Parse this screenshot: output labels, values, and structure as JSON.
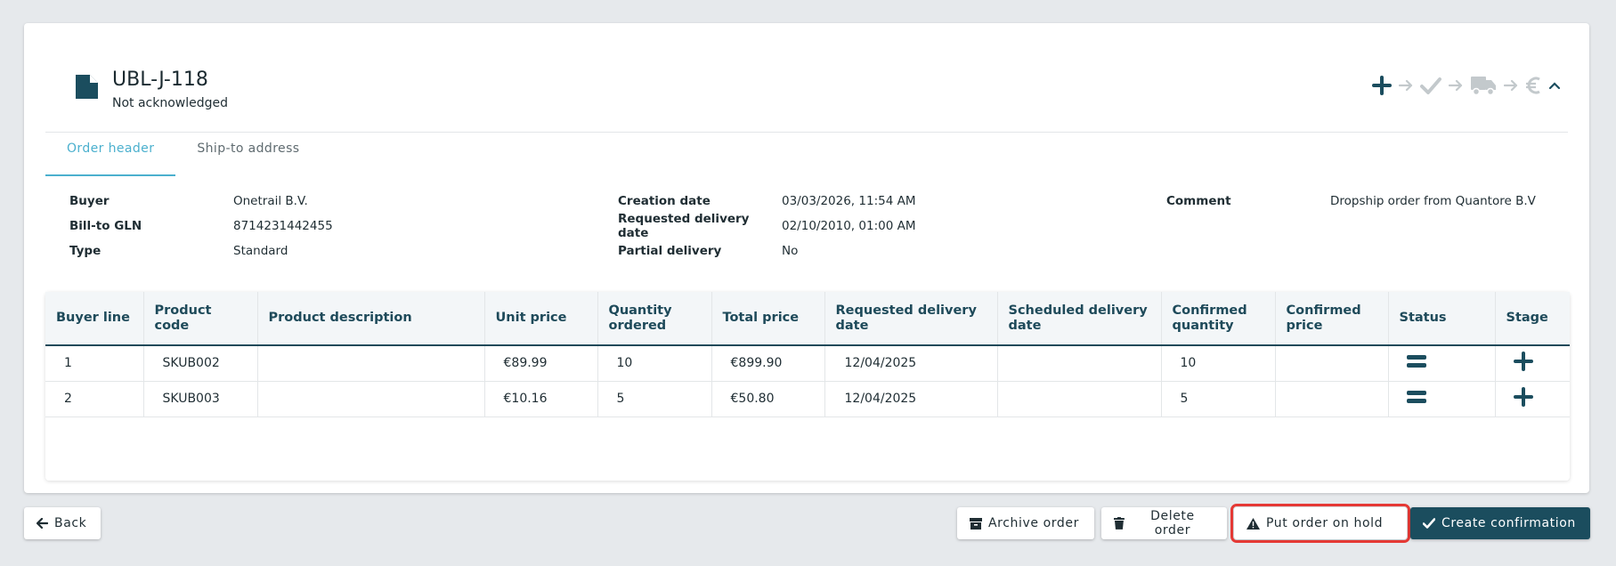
{
  "order": {
    "title": "UBL-J-118",
    "status": "Not acknowledged"
  },
  "stage_icons": [
    "plus-icon",
    "arrow-right-icon",
    "check-icon",
    "arrow-right-icon",
    "truck-icon",
    "arrow-right-icon",
    "euro-icon",
    "chevron-up-icon"
  ],
  "tabs": [
    {
      "label": "Order header",
      "active": true
    },
    {
      "label": "Ship-to address",
      "active": false
    }
  ],
  "fields": {
    "buyer": {
      "label": "Buyer",
      "value": "Onetrail B.V."
    },
    "bill_to_gln": {
      "label": "Bill-to GLN",
      "value": "8714231442455"
    },
    "type": {
      "label": "Type",
      "value": "Standard"
    },
    "creation_date": {
      "label": "Creation date",
      "value": "03/03/2026, 11:54 AM"
    },
    "requested_delivery_date": {
      "label": "Requested delivery date",
      "value": "02/10/2010, 01:00 AM"
    },
    "partial_delivery": {
      "label": "Partial delivery",
      "value": "No"
    },
    "comment": {
      "label": "Comment",
      "value": "Dropship order from Quantore B.V"
    }
  },
  "table": {
    "columns": [
      "Buyer line",
      "Product code",
      "Product description",
      "Unit price",
      "Quantity ordered",
      "Total price",
      "Requested delivery date",
      "Scheduled delivery date",
      "Confirmed quantity",
      "Confirmed price",
      "Status",
      "Stage"
    ],
    "rows": [
      {
        "buyer_line": "1",
        "product_code": "SKUB002",
        "product_description": "",
        "unit_price": "€89.99",
        "quantity_ordered": "10",
        "total_price": "€899.90",
        "requested_delivery_date": "12/04/2025",
        "scheduled_delivery_date": "",
        "confirmed_quantity": "10",
        "confirmed_price": "",
        "status_icon": "equals-icon",
        "stage_icon": "plus-icon"
      },
      {
        "buyer_line": "2",
        "product_code": "SKUB003",
        "product_description": "",
        "unit_price": "€10.16",
        "quantity_ordered": "5",
        "total_price": "€50.80",
        "requested_delivery_date": "12/04/2025",
        "scheduled_delivery_date": "",
        "confirmed_quantity": "5",
        "confirmed_price": "",
        "status_icon": "equals-icon",
        "stage_icon": "plus-icon"
      }
    ]
  },
  "buttons": {
    "back": "Back",
    "archive": "Archive order",
    "delete": "Delete order",
    "hold": "Put order on hold",
    "create": "Create confirmation"
  },
  "colors": {
    "primary": "#1b4d5e",
    "accent_tab": "#4bb0ce",
    "highlight": "#e53935",
    "inactive_icon": "#c3c9cc"
  }
}
